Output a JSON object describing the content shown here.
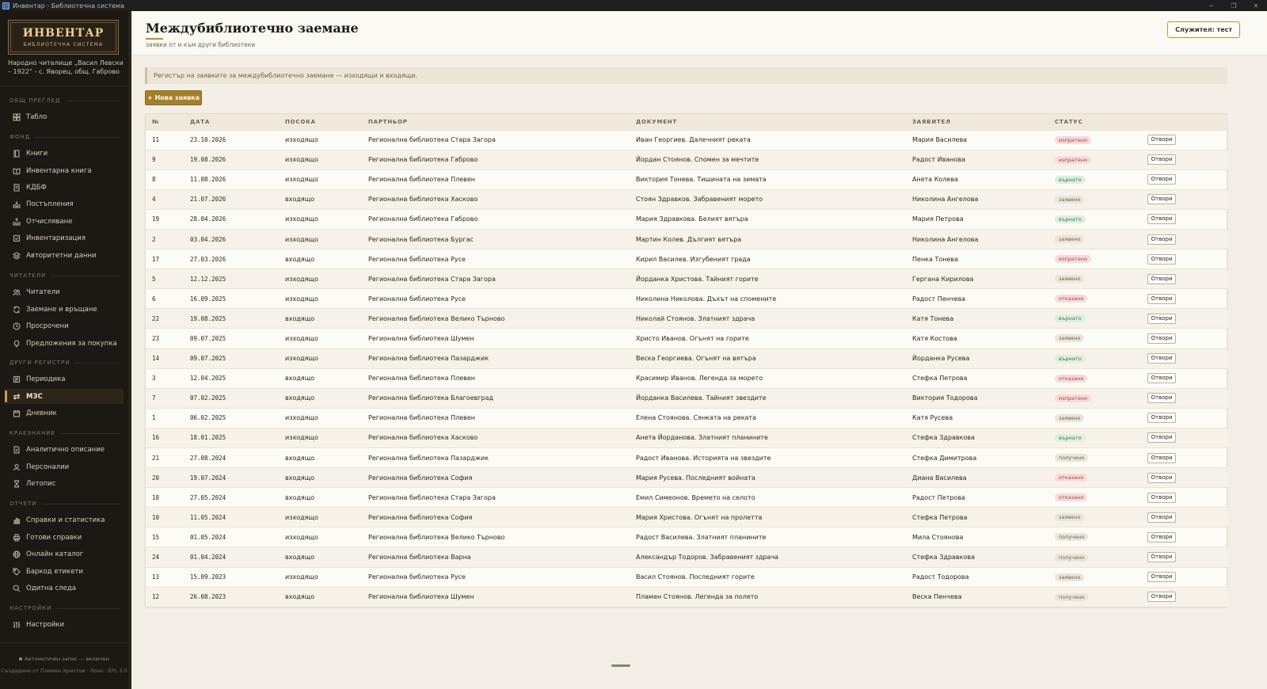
{
  "window": {
    "title": "Инвентар - Библиотечна система"
  },
  "brand": {
    "name": "ИНВЕНТАР",
    "subtitle": "БИБЛИОТЕЧНА СИСТЕМА"
  },
  "org": {
    "name": "Народно читалище „Васил Левски – 1922“ - с. Яворец, общ. Габрово"
  },
  "sections": {
    "overview": "ОБЩ ПРЕГЛЕД",
    "fund": "ФОНД",
    "readers": "ЧИТАТЕЛИ",
    "other": "ДРУГИ РЕГИСТРИ",
    "local": "КРАЕЗНАНИЕ",
    "reports": "ОТЧЕТИ",
    "settings": "НАСТРОЙКИ"
  },
  "nav": {
    "dashboard": "Табло",
    "books": "Книги",
    "inventory_book": "Инвентарна книга",
    "kdbf": "КДБФ",
    "receipts": "Постъпления",
    "writeoff": "Отчисляване",
    "inventarization": "Инвентаризация",
    "authority": "Авторитетни данни",
    "readers": "Читатели",
    "loans": "Заемане и връщане",
    "overdue": "Просрочени",
    "suggestions": "Предложения за покупка",
    "periodicals": "Периодика",
    "ill": "МЗС",
    "diary": "Дневник",
    "analytic": "Аналитично описание",
    "persons": "Персоналии",
    "chronicle": "Летопис",
    "stats": "Справки и статистика",
    "ready_reports": "Готови справки",
    "catalog": "Онлайн каталог",
    "barcode": "Баркод етикети",
    "audit": "Одитна следа",
    "settings": "Настройки"
  },
  "footer": {
    "autosave": "Автоматичен запис — включен",
    "credit": "Създадено от Пламен Христов · Лоно · EPL 3.0"
  },
  "header": {
    "title": "Междубиблиотечно заемане",
    "subtitle": "заявки от и към други библиотеки",
    "user": "Служител: тест"
  },
  "notice": "Регистър на заявките за междубиблиотечно заемане — изходящи и входящи.",
  "new_button": "+ Нова заявка",
  "table": {
    "headers": [
      "№",
      "ДАТА",
      "ПОСОКА",
      "ПАРТНЬОР",
      "ДОКУМЕНТ",
      "ЗАЯВИТЕЛ",
      "СТАТУС"
    ],
    "action_label": "Отвори",
    "rows": [
      {
        "no": "11",
        "date": "23.10.2026",
        "dir": "изходящо",
        "partner": "Регионална библиотека Стара Загора",
        "doc": "Иван Георгиев. Далечният реката",
        "req": "Мария Василева",
        "status": "изпратено",
        "tone": "red"
      },
      {
        "no": "9",
        "date": "19.08.2026",
        "dir": "изходящо",
        "partner": "Регионална библиотека Габрово",
        "doc": "Йордан Стоянов. Спомен за мечтите",
        "req": "Радост Иванова",
        "status": "изпратено",
        "tone": "red"
      },
      {
        "no": "8",
        "date": "11.08.2026",
        "dir": "изходящо",
        "partner": "Регионална библиотека Плевен",
        "doc": "Виктория Тонева. Тишината на зимата",
        "req": "Анета Колева",
        "status": "върнато",
        "tone": "green"
      },
      {
        "no": "4",
        "date": "21.07.2026",
        "dir": "входящо",
        "partner": "Регионална библиотека Хасково",
        "doc": "Стоян Здравков. Забравеният морето",
        "req": "Николина Ангелова",
        "status": "заявено",
        "tone": "neutral"
      },
      {
        "no": "19",
        "date": "28.04.2026",
        "dir": "изходящо",
        "partner": "Регионална библиотека Габрово",
        "doc": "Мария Здравкова. Белият вятъра",
        "req": "Мария Петрова",
        "status": "върнато",
        "tone": "green"
      },
      {
        "no": "2",
        "date": "03.04.2026",
        "dir": "изходящо",
        "partner": "Регионална библиотека Бургас",
        "doc": "Мартин Колев. Дългият вятъра",
        "req": "Николина Ангелова",
        "status": "заявено",
        "tone": "neutral"
      },
      {
        "no": "17",
        "date": "27.03.2026",
        "dir": "входящо",
        "partner": "Регионална библиотека Русе",
        "doc": "Кирил Василев. Изгубеният града",
        "req": "Пенка Тонева",
        "status": "изпратено",
        "tone": "red"
      },
      {
        "no": "5",
        "date": "12.12.2025",
        "dir": "изходящо",
        "partner": "Регионална библиотека Стара Загора",
        "doc": "Йорданка Христова. Тайният горите",
        "req": "Гергана Кирилова",
        "status": "заявено",
        "tone": "neutral"
      },
      {
        "no": "6",
        "date": "16.09.2025",
        "dir": "изходящо",
        "partner": "Регионална библиотека Русе",
        "doc": "Николина Николова. Дъхът на спомените",
        "req": "Радост Пенчева",
        "status": "отказано",
        "tone": "red"
      },
      {
        "no": "22",
        "date": "19.08.2025",
        "dir": "входящо",
        "partner": "Регионална библиотека Велико Търново",
        "doc": "Николай Стоянов. Златният здрача",
        "req": "Катя Тонева",
        "status": "върнато",
        "tone": "green"
      },
      {
        "no": "23",
        "date": "09.07.2025",
        "dir": "изходящо",
        "partner": "Регионална библиотека Шумен",
        "doc": "Христо Иванов. Огънят на горите",
        "req": "Катя Костова",
        "status": "заявено",
        "tone": "neutral"
      },
      {
        "no": "14",
        "date": "09.07.2025",
        "dir": "изходящо",
        "partner": "Регионална библиотека Пазарджик",
        "doc": "Веска Георгиева. Огънят на вятъра",
        "req": "Йорданка Русева",
        "status": "върнато",
        "tone": "green"
      },
      {
        "no": "3",
        "date": "12.04.2025",
        "dir": "входящо",
        "partner": "Регионална библиотека Плевен",
        "doc": "Красимир Иванов. Легенда за морето",
        "req": "Стефка Петрова",
        "status": "отказано",
        "tone": "red"
      },
      {
        "no": "7",
        "date": "07.02.2025",
        "dir": "входящо",
        "partner": "Регионална библиотека Благоевград",
        "doc": "Йорданка Василева. Тайният звездите",
        "req": "Виктория Тодорова",
        "status": "изпратено",
        "tone": "red"
      },
      {
        "no": "1",
        "date": "06.02.2025",
        "dir": "изходящо",
        "partner": "Регионална библиотека Плевен",
        "doc": "Елена Стоянова. Сянката на реката",
        "req": "Катя Русева",
        "status": "заявено",
        "tone": "neutral"
      },
      {
        "no": "16",
        "date": "18.01.2025",
        "dir": "изходящо",
        "partner": "Регионална библиотека Хасково",
        "doc": "Анета Йорданова. Златният планините",
        "req": "Стефка Здравкова",
        "status": "върнато",
        "tone": "green"
      },
      {
        "no": "21",
        "date": "27.08.2024",
        "dir": "входящо",
        "partner": "Регионална библиотека Пазарджик",
        "doc": "Радост Иванова. Историята на звездите",
        "req": "Стефка Димитрова",
        "status": "получено",
        "tone": "neutral"
      },
      {
        "no": "20",
        "date": "19.07.2024",
        "dir": "входящо",
        "partner": "Регионална библиотека София",
        "doc": "Мария Русева. Последният войната",
        "req": "Диана Василева",
        "status": "отказано",
        "tone": "red"
      },
      {
        "no": "18",
        "date": "27.05.2024",
        "dir": "входящо",
        "partner": "Регионална библиотека Стара Загора",
        "doc": "Емил Симеонов. Времето на селото",
        "req": "Радост Петрова",
        "status": "отказано",
        "tone": "red"
      },
      {
        "no": "10",
        "date": "11.05.2024",
        "dir": "изходящо",
        "partner": "Регионална библиотека София",
        "doc": "Мария Христова. Огънят на пролетта",
        "req": "Стефка Петрова",
        "status": "заявено",
        "tone": "neutral"
      },
      {
        "no": "15",
        "date": "01.05.2024",
        "dir": "изходящо",
        "partner": "Регионална библиотека Велико Търново",
        "doc": "Радост Василева. Златният планините",
        "req": "Мила Стоянова",
        "status": "получено",
        "tone": "neutral"
      },
      {
        "no": "24",
        "date": "01.04.2024",
        "dir": "входящо",
        "partner": "Регионална библиотека Варна",
        "doc": "Александър Тодоров. Забравеният здрача",
        "req": "Стефка Здравкова",
        "status": "получено",
        "tone": "neutral"
      },
      {
        "no": "13",
        "date": "15.09.2023",
        "dir": "изходящо",
        "partner": "Регионална библиотека Русе",
        "doc": "Васил Стоянов. Последният горите",
        "req": "Радост Тодорова",
        "status": "заявено",
        "tone": "neutral"
      },
      {
        "no": "12",
        "date": "26.08.2023",
        "dir": "входящо",
        "partner": "Регионална библиотека Шумен",
        "doc": "Пламен Стоянов. Легенда за полето",
        "req": "Веска Пенчева",
        "status": "получено",
        "tone": "neutral"
      }
    ]
  }
}
